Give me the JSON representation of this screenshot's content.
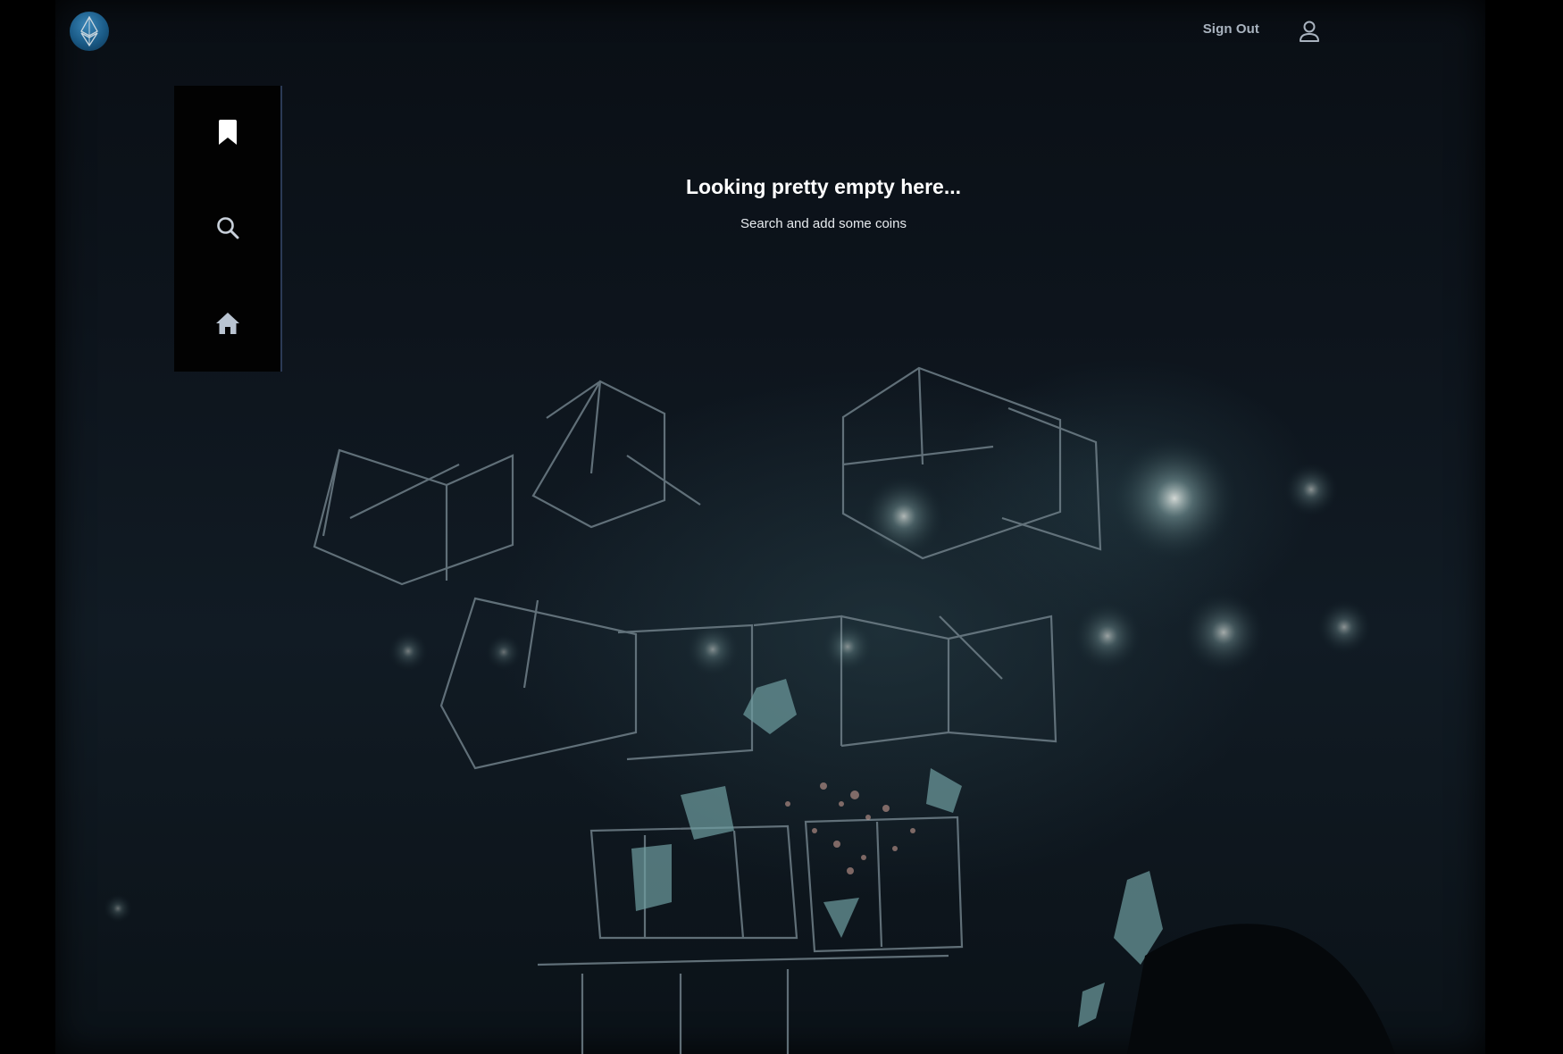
{
  "header": {
    "logo_icon": "ethereum-logo-icon",
    "sign_out_label": "Sign Out",
    "account_icon": "user-icon"
  },
  "sidebar": {
    "items": [
      {
        "icon": "bookmark-icon",
        "name": "bookmarks"
      },
      {
        "icon": "search-icon",
        "name": "search"
      },
      {
        "icon": "home-icon",
        "name": "home"
      }
    ]
  },
  "main": {
    "empty_title": "Looking pretty empty here...",
    "empty_subtitle": "Search and add some coins"
  },
  "colors": {
    "sidebar_border": "#2b3a55",
    "logo": "#1a5a86",
    "text_muted": "#a9b3bf"
  }
}
